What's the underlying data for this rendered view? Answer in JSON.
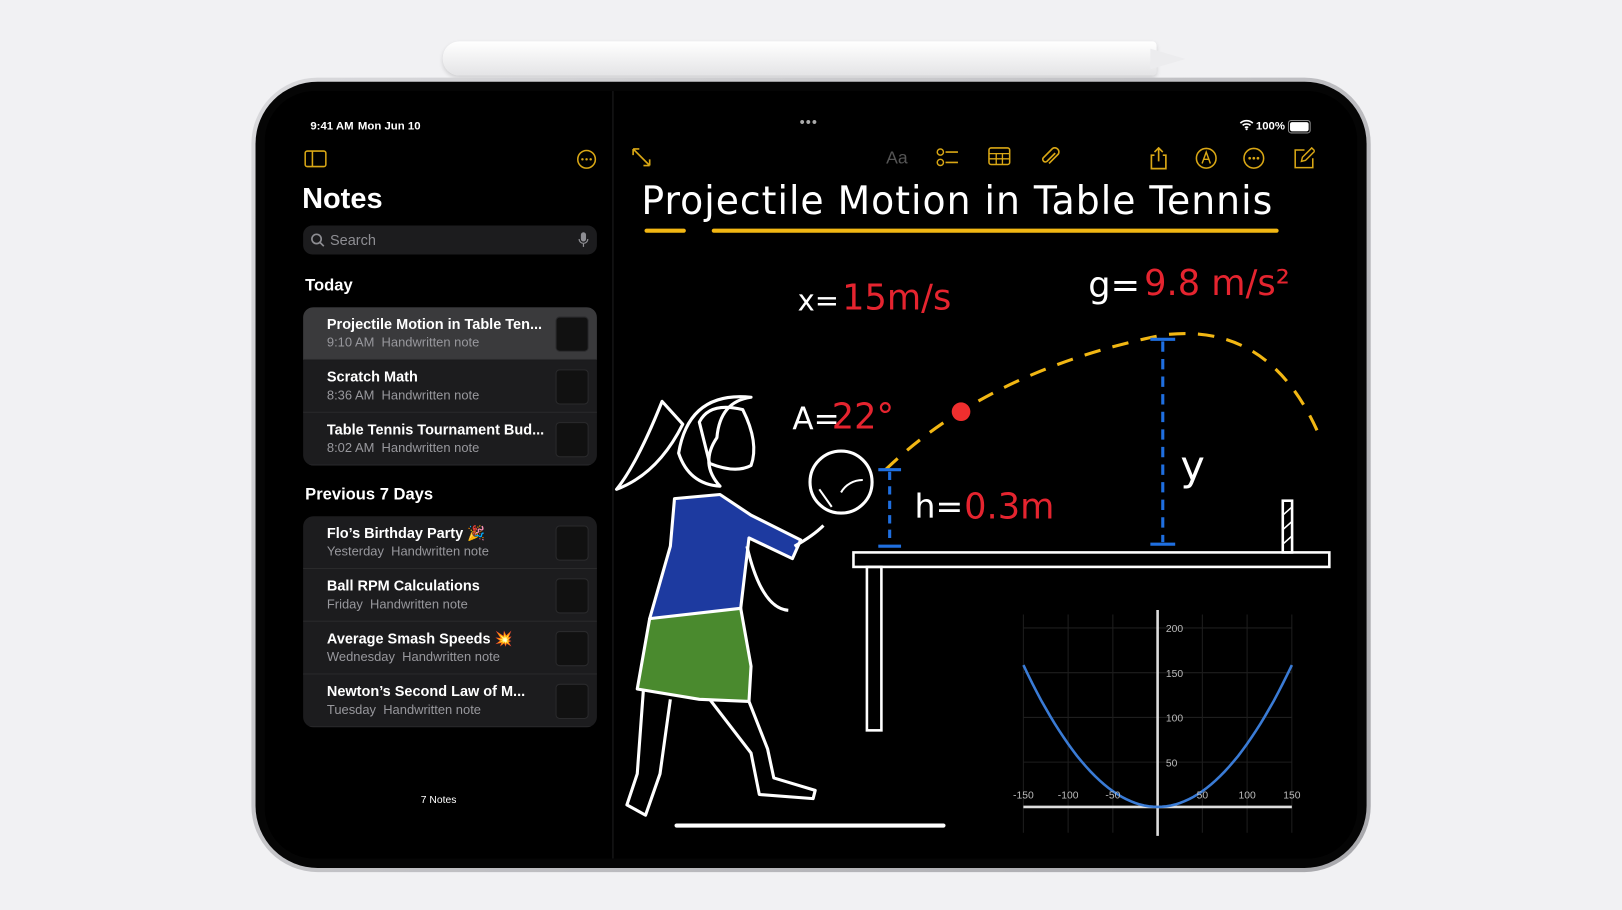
{
  "status_bar": {
    "time": "9:41 AM",
    "date": "Mon Jun 10",
    "battery": "100%"
  },
  "sidebar": {
    "title": "Notes",
    "search_placeholder": "Search",
    "sections": [
      {
        "label": "Today",
        "notes": [
          {
            "title": "Projectile Motion in Table Ten...",
            "time": "9:10 AM",
            "type": "Handwritten note",
            "selected": true
          },
          {
            "title": "Scratch Math",
            "time": "8:36 AM",
            "type": "Handwritten note"
          },
          {
            "title": "Table Tennis Tournament Bud...",
            "time": "8:02 AM",
            "type": "Handwritten note"
          }
        ]
      },
      {
        "label": "Previous 7 Days",
        "notes": [
          {
            "title": "Flo’s Birthday Party 🎉",
            "time": "Yesterday",
            "type": "Handwritten note"
          },
          {
            "title": "Ball RPM Calculations",
            "time": "Friday",
            "type": "Handwritten note"
          },
          {
            "title": "Average Smash Speeds 💥",
            "time": "Wednesday",
            "type": "Handwritten note"
          },
          {
            "title": "Newton’s Second Law of M...",
            "time": "Tuesday",
            "type": "Handwritten note"
          }
        ]
      }
    ],
    "note_count": "7 Notes"
  },
  "toolbar": {
    "format_label": "Aa",
    "icons": [
      "expand-icon",
      "format-icon",
      "checklist-icon",
      "table-icon",
      "attachment-icon",
      "share-icon",
      "markup-icon",
      "more-icon",
      "compose-icon"
    ]
  },
  "canvas": {
    "title": "Projectile Motion in Table Tennis",
    "labels": {
      "x_var": "x=",
      "x_val": "15m/s",
      "g_var": "g=",
      "g_val": "9.8 m/s²",
      "a_var": "A=",
      "a_val": "22°",
      "h_var": "h=",
      "h_val": "0.3m",
      "y_var": "y"
    },
    "graph": {
      "x_ticks": [
        "-150",
        "-100",
        "-50",
        "50",
        "100",
        "150"
      ],
      "y_ticks": [
        "50",
        "100",
        "150",
        "200"
      ],
      "curve": {
        "x": [
          -150,
          -100,
          -50,
          0,
          50,
          100,
          150
        ],
        "y": [
          158,
          70,
          18,
          0,
          18,
          70,
          158
        ]
      },
      "color": "#3a7bd5"
    }
  },
  "colors": {
    "accent": "#d9a715",
    "handwriting_red": "#e5242f",
    "trajectory": "#f2b713",
    "measure_blue": "#1f6fe0"
  }
}
